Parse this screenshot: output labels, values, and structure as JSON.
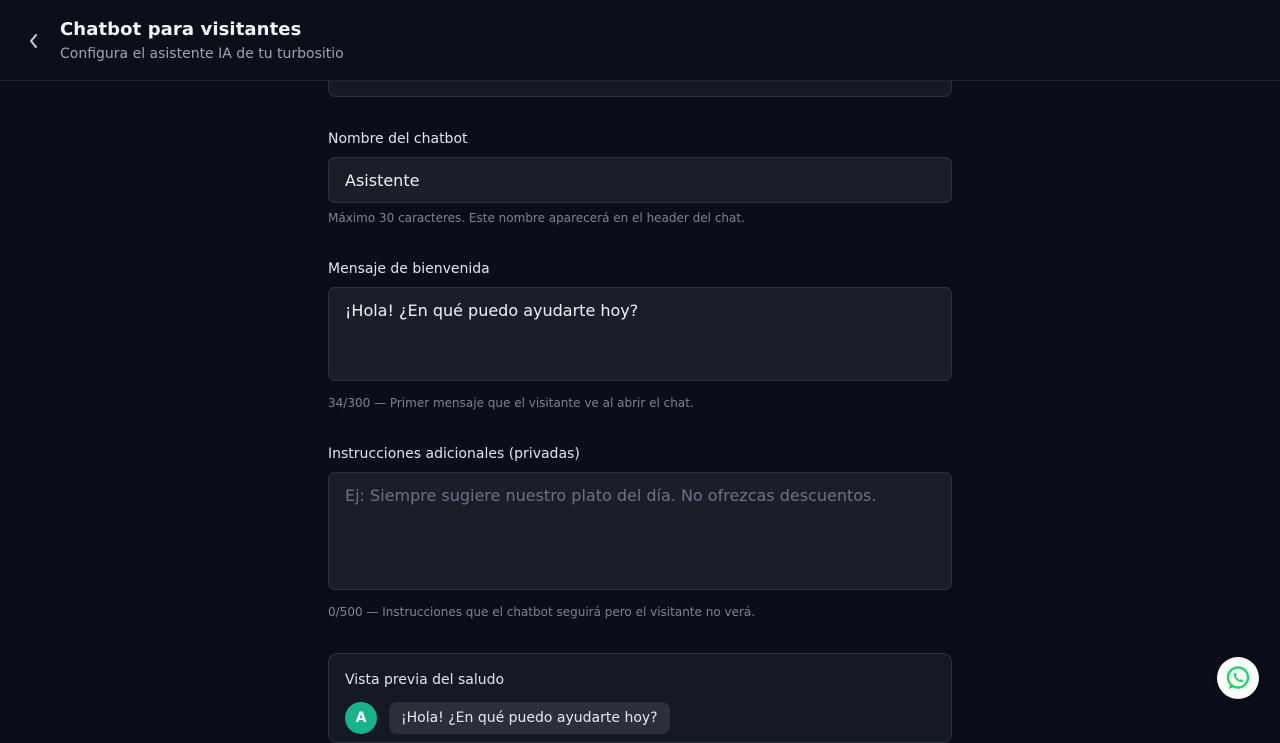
{
  "header": {
    "title": "Chatbot para visitantes",
    "subtitle": "Configura el asistente IA de tu turbositio"
  },
  "form": {
    "name": {
      "label": "Nombre del chatbot",
      "value": "Asistente",
      "helper": "Máximo 30 caracteres. Este nombre aparecerá en el header del chat."
    },
    "welcome": {
      "label": "Mensaje de bienvenida",
      "value": "¡Hola! ¿En qué puedo ayudarte hoy?",
      "helper": "34/300 — Primer mensaje que el visitante ve al abrir el chat."
    },
    "instructions": {
      "label": "Instrucciones adicionales (privadas)",
      "value": "",
      "placeholder": "Ej: Siempre sugiere nuestro plato del día. No ofrezcas descuentos.",
      "helper": "0/500 — Instrucciones que el chatbot seguirá pero el visitante no verá."
    }
  },
  "preview": {
    "title": "Vista previa del saludo",
    "avatar_initial": "A",
    "bubble_text": "¡Hola! ¿En qué puedo ayudarte hoy?"
  },
  "icons": {
    "back": "chevron-left-icon",
    "whatsapp": "whatsapp-icon"
  },
  "colors": {
    "background": "#0a0e18",
    "avatar": "#19b38a",
    "whatsapp": "#25D366"
  }
}
